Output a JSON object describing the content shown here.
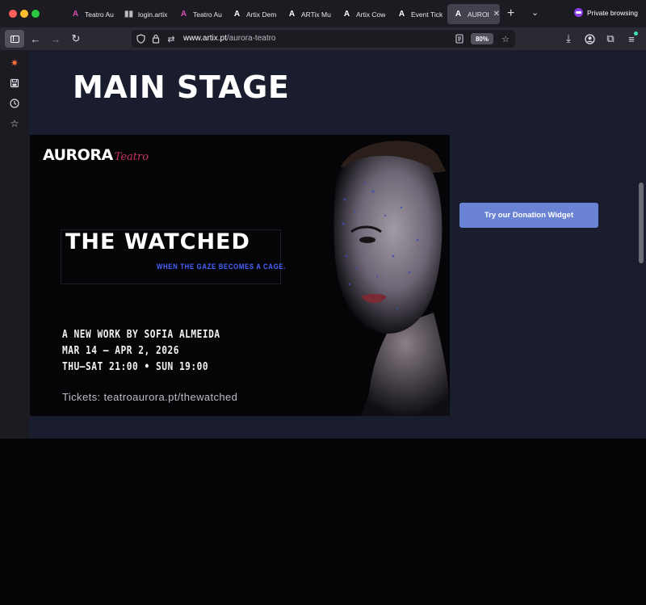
{
  "browser": {
    "tabs": [
      {
        "label": "Teatro Au",
        "icon": "aurora-a-icon"
      },
      {
        "label": "login.artix",
        "icon": "barcode-icon"
      },
      {
        "label": "Teatro Au",
        "icon": "aurora-a-icon"
      },
      {
        "label": "Artix Dem",
        "icon": "artix-a-icon"
      },
      {
        "label": "ARTix Mu",
        "icon": "artix-a-icon"
      },
      {
        "label": "Artix Cow",
        "icon": "artix-a-icon"
      },
      {
        "label": "Event Tick",
        "icon": "artix-a-icon"
      },
      {
        "label": "AURORA",
        "icon": "artix-a-icon",
        "active": true
      }
    ],
    "private_label": "Private browsing",
    "url_host": "www.artix.pt",
    "url_path": "/aurora-teatro",
    "zoom": "80%"
  },
  "page": {
    "title": "MAIN STAGE",
    "donate_button": "Try our Donation Widget"
  },
  "poster": {
    "logo_main": "AURORA",
    "logo_sub": "Teatro",
    "show_title": "THE WATCHED",
    "tagline": "WHEN THE GAZE BECOMES A CAGE.",
    "credit": "A NEW WORK BY SOFIA ALMEIDA",
    "dates": "MAR 14 – APR 2, 2026",
    "times": "THU–SAT 21:00 • SUN 19:00",
    "tickets": "Tickets:  teatroaurora.pt/thewatched"
  },
  "colors": {
    "accent": "#6a83d4",
    "tagline": "#4a64ff",
    "logo_sub": "#c8335f",
    "page_bg": "#1a1d2e"
  }
}
